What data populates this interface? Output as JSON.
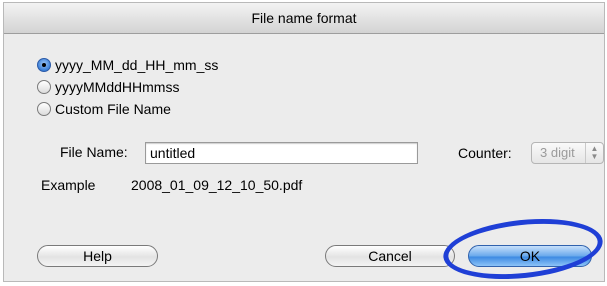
{
  "dialog": {
    "title": "File name format",
    "format_options": [
      {
        "label": "yyyy_MM_dd_HH_mm_ss",
        "selected": true
      },
      {
        "label": "yyyyMMddHHmmss",
        "selected": false
      },
      {
        "label": "Custom File Name",
        "selected": false
      }
    ],
    "file_name_label": "File Name:",
    "file_name_value": "untitled",
    "counter_label": "Counter:",
    "counter_value": "3 digit",
    "example_label": "Example",
    "example_value": "2008_01_09_12_10_50.pdf",
    "buttons": {
      "help": "Help",
      "cancel": "Cancel",
      "ok": "OK"
    }
  },
  "colors": {
    "annotation": "#1f3fd6",
    "default_button": "#3d8ae3"
  }
}
